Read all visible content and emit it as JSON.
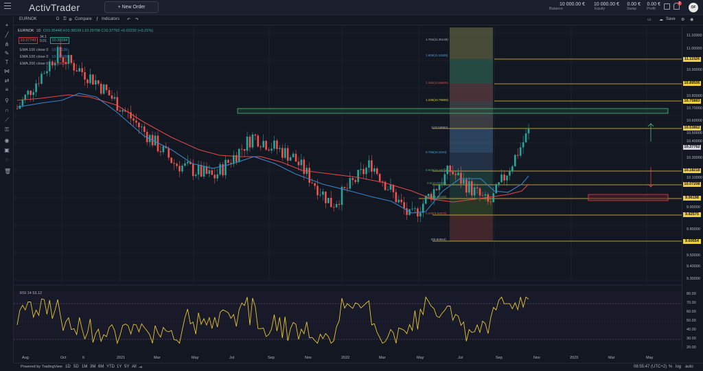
{
  "header": {
    "brand": "ActivTrader",
    "new_order": "+  New Order",
    "account": [
      {
        "value": "10 000.00 €",
        "label": "Balance"
      },
      {
        "value": "10 000.00 €",
        "label": "Equity"
      },
      {
        "value": "0.00 €",
        "label": "Swap"
      },
      {
        "value": "0.00 €",
        "label": "Profit"
      }
    ],
    "notif_count": "2",
    "avatar": "OF"
  },
  "chart_toolbar": {
    "symbol": "EURNOK",
    "interval": "D",
    "compare": "Compare",
    "indicators": "Indicators",
    "save": "Save"
  },
  "legend": {
    "symbol": "EURNOK",
    "interval": "1D",
    "ohlc": "O10.35448 H10.38109 L10.29708 C10.37762 +0.02232 (+0.21%)",
    "sell_price": "10.37743",
    "buy_price": "10.38084",
    "spread_top": "34.1",
    "spread_bottom": "0.01",
    "ema_lines": [
      {
        "label": "EMA 100 close 0",
        "value": "10.15139",
        "color": "#3b82c4"
      },
      {
        "label": "EMA 100 close 0",
        "value": "10.15139",
        "color": "#3b82c4"
      },
      {
        "label": "EMA 200 close 0",
        "value": "10.09934",
        "color": "#e04848"
      }
    ],
    "rsi": "RSI 14  53.12"
  },
  "fib_labels": [
    {
      "text": "1.764(11.25149)",
      "color": "#b2b5be"
    },
    {
      "text": "1.618(11.11526)",
      "color": "#4fa3e0"
    },
    {
      "text": "1.382(10.89506)",
      "color": "#e04848"
    },
    {
      "text": "1.236(10.75883)",
      "color": "#d8d050"
    },
    {
      "text": "1(10.53862)",
      "color": "#b2b5be"
    },
    {
      "text": "0.786(10.3194)",
      "color": "#4fa3e0"
    },
    {
      "text": "0.618(10.18218)",
      "color": "#5aa06a"
    },
    {
      "text": "0.5(10.07208)",
      "color": "#5aa06a"
    },
    {
      "text": "0.382(9.96198)",
      "color": "#5aa06a"
    },
    {
      "text": "0.236(9.82575)",
      "color": "#e04848"
    },
    {
      "text": "0(9.60554)",
      "color": "#b2b5be"
    }
  ],
  "price_axis": [
    "11.10000",
    "11.00000",
    "10.90000",
    "10.80000",
    "10.70000",
    "10.60000",
    "10.50000",
    "10.40000",
    "10.30000",
    "10.20000",
    "10.10000",
    "10.00000",
    "9.90000",
    "9.80000",
    "9.70000",
    "9.60000",
    "9.50000",
    "9.40000",
    "9.30000"
  ],
  "price_tags": [
    {
      "text": "11.11526",
      "type": "level"
    },
    {
      "text": "10.89506",
      "type": "level"
    },
    {
      "text": "10.75883",
      "type": "level"
    },
    {
      "text": "10.53862",
      "type": "level"
    },
    {
      "text": "10.37762",
      "type": "current"
    },
    {
      "text": "10.18218",
      "type": "level"
    },
    {
      "text": "10.07208",
      "type": "level"
    },
    {
      "text": "9.96198",
      "type": "level"
    },
    {
      "text": "9.82575",
      "type": "level"
    },
    {
      "text": "9.60554",
      "type": "level"
    }
  ],
  "rsi_axis": [
    "80.00",
    "70.00",
    "60.00",
    "50.00",
    "40.00",
    "30.00",
    "20.00"
  ],
  "time_axis": [
    "Aug",
    "Oct",
    "6",
    "2021",
    "Mar",
    "May",
    "Jul",
    "Sep",
    "Nov",
    "2022",
    "Mar",
    "May",
    "Jul",
    "Sep",
    "Nov",
    "2023",
    "Mar",
    "May"
  ],
  "footer": {
    "powered": "Powered by TradingView",
    "timeframes": [
      "1D",
      "5D",
      "1M",
      "3M",
      "6M",
      "YTD",
      "1Y",
      "5Y",
      "All"
    ],
    "clock": "08:55:47 (UTC+2)",
    "pct": "%",
    "log": "log",
    "auto": "auto"
  },
  "chart_data": [
    {
      "type": "line",
      "title": "EURNOK 1D",
      "description": "Candlestick price series with EMA100 (blue) and EMA200 (red); Fibonacci extension overlay",
      "x": [
        "Aug 2020",
        "Oct 2020",
        "Dec 2020",
        "2021",
        "Mar 2021",
        "May 2021",
        "Jul 2021",
        "Sep 2021",
        "Nov 2021",
        "2022",
        "Mar 2022",
        "May 2022",
        "Jul 2022",
        "Sep 2022"
      ],
      "series": [
        {
          "name": "Close",
          "values": [
            10.55,
            10.95,
            10.75,
            10.45,
            10.15,
            10.05,
            10.35,
            10.2,
            9.85,
            10.15,
            9.75,
            10.1,
            9.85,
            10.38
          ]
        },
        {
          "name": "EMA 100",
          "values": [
            10.6,
            10.7,
            10.68,
            10.5,
            10.25,
            10.15,
            10.2,
            10.2,
            10.05,
            10.0,
            9.95,
            9.98,
            10.1,
            10.15
          ]
        },
        {
          "name": "EMA 200",
          "values": [
            10.55,
            10.62,
            10.65,
            10.55,
            10.4,
            10.28,
            10.22,
            10.22,
            10.12,
            10.08,
            10.05,
            10.0,
            10.0,
            10.1
          ]
        }
      ],
      "ylim": [
        9.3,
        11.1
      ]
    },
    {
      "type": "line",
      "title": "RSI 14",
      "values_summary": "RSI oscillating between ~20 and ~78, last 53.12",
      "ylim": [
        20,
        80
      ],
      "bands": [
        30,
        70
      ],
      "series": [
        {
          "name": "RSI",
          "values": [
            55,
            70,
            45,
            60,
            38,
            65,
            50,
            72,
            40,
            58,
            32,
            62,
            48,
            75,
            35,
            60,
            53.12
          ]
        }
      ]
    }
  ]
}
